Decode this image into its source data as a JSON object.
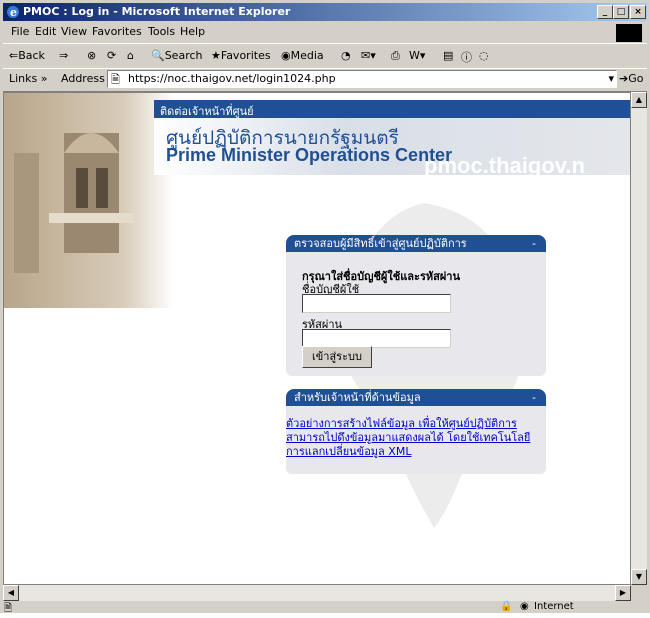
{
  "window": {
    "title": "PMOC : Log in - Microsoft Internet Explorer",
    "controls": [
      "_",
      "□",
      "×"
    ]
  },
  "menubar": {
    "items": [
      "File",
      "Edit",
      "View",
      "Favorites",
      "Tools",
      "Help"
    ]
  },
  "toolbar": {
    "back": "⇐Back",
    "forward": "⇒",
    "stop": "⊗",
    "refresh": "⟳",
    "home": "⌂",
    "search": "Search",
    "favorites": "Favorites",
    "media": "Media"
  },
  "addressbar": {
    "links_label": "Links",
    "address_label": "Address",
    "url": "https://noc.thaigov.net/login1024.php",
    "go_label": "Go"
  },
  "page": {
    "top_link": "ติดต่อเจ้าหน้าที่ศูนย์",
    "site_name_th": "ศูนย์ปฏิบัติการนายกรัฐมนตรี",
    "site_name_en": "Prime Minister Operations Center",
    "watermark": "pmoc.thaigov.n",
    "login_panel": {
      "header": "ตรวจสอบผู้มีสิทธิ์เข้าสู่ศูนย์ปฏิบัติการ",
      "collapse": "-",
      "instruction": "กรุณาใส่ชื่อบัญชีผู้ใช้และรหัสผ่าน",
      "username_label": "ชื่อบัญชีผู้ใช้",
      "password_label": "รหัสผ่าน",
      "submit_label": "เข้าสู่ระบบ"
    },
    "data_panel": {
      "header": "สำหรับเจ้าหน้าที่ด้านข้อมูล",
      "collapse": "-",
      "link_text": "ตัวอย่างการสร้างไฟล์ข้อมูล เพื่อให้ศูนย์ปฏิบัติการ สามารถไปดึงข้อมูลมาแสดงผลได้ โดยใช้เทคโนโลยีการแลกเปลี่ยนข้อมูล XML"
    }
  },
  "statusbar": {
    "zone": "Internet"
  },
  "colors": {
    "title_gradient_start": "#0a246a",
    "title_gradient_end": "#a6caf0",
    "brand_blue": "#1f4f95",
    "link": "#0000cc"
  }
}
